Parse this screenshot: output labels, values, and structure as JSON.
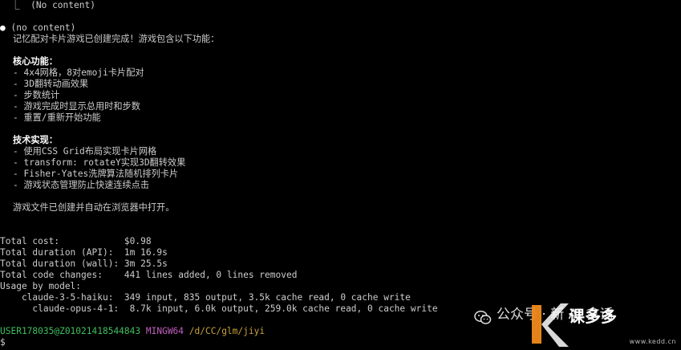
{
  "terminal": {
    "prev_tool_output": "  ⎿  (No content)",
    "bullet": "●",
    "bullet_text": "(no content)",
    "summary_line": "记忆配对卡片游戏已创建完成！游戏包含以下功能：",
    "core_heading": "核心功能：",
    "core_items": [
      "- 4x4网格，8对emoji卡片配对",
      "- 3D翻转动画效果",
      "- 步数统计",
      "- 游戏完成时显示总用时和步数",
      "- 重置/重新开始功能"
    ],
    "tech_heading": "技术实现：",
    "tech_items": [
      "- 使用CSS Grid布局实现卡片网格",
      "- transform: rotateY实现3D翻转效果",
      "- Fisher-Yates洗牌算法随机排列卡片",
      "- 游戏状态管理防止快速连续点击"
    ],
    "final_note": "游戏文件已创建并自动在浏览器中打开。",
    "stats": [
      "Total cost:            $0.98",
      "Total duration (API):  1m 16.9s",
      "Total duration (wall): 3m 25.5s",
      "Total code changes:    441 lines added, 0 lines removed",
      "Usage by model:",
      "    claude-3-5-haiku:  349 input, 835 output, 3.5k cache read, 0 cache write",
      "      claude-opus-4-1:  8.7k input, 6.0k output, 259.0k cache read, 0 cache write"
    ],
    "prompt_user": "USER178035@Z01021418544843",
    "prompt_host": "MINGW64",
    "prompt_path": "/d/CC/glm/jiyi",
    "prompt_symbol": "$"
  },
  "watermark": {
    "channel_text": "公众号 · 新 AI 拿话",
    "brand_text": "课多多",
    "url": "www.kedd.cn",
    "icon": "wechat-icon",
    "logo_color": "#f08a1c"
  },
  "colors": {
    "background": "#000000",
    "text": "#cccccc",
    "prompt_user": "#3fbf5f",
    "prompt_host": "#c060c0",
    "prompt_path": "#c8a23a"
  }
}
